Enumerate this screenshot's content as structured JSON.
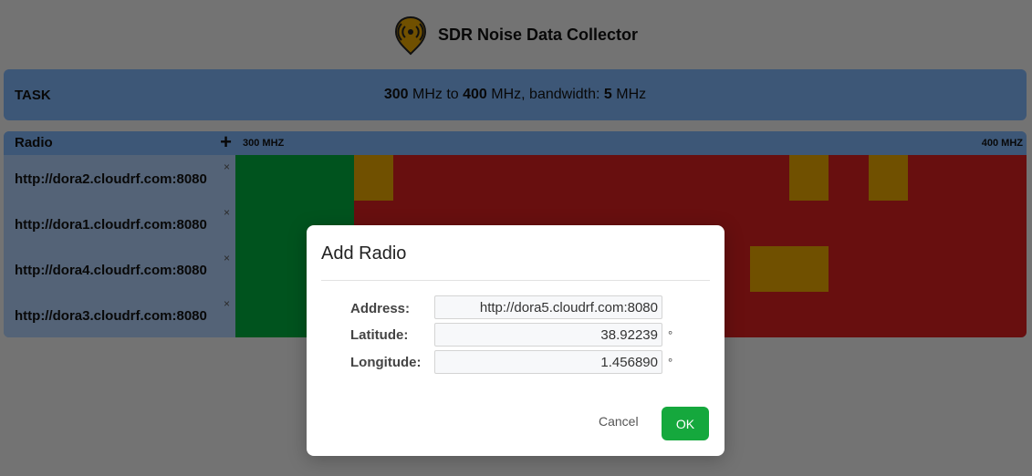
{
  "app": {
    "title": "SDR Noise Data Collector"
  },
  "task": {
    "label": "TASK",
    "freq_from": "300",
    "unit_from": "MHz",
    "to_word": "to",
    "freq_to": "400",
    "unit_to": "MHz, bandwidth:",
    "bandwidth": "5",
    "bandwidth_unit": "MHz"
  },
  "radios": {
    "header": "Radio",
    "add_symbol": "+",
    "remove_symbol": "×",
    "freq_start": "300 MHZ",
    "freq_end": "400 MHZ",
    "items": [
      {
        "url": "http://dora2.cloudrf.com:8080"
      },
      {
        "url": "http://dora1.cloudrf.com:8080"
      },
      {
        "url": "http://dora4.cloudrf.com:8080"
      },
      {
        "url": "http://dora3.cloudrf.com:8080"
      }
    ]
  },
  "colors": {
    "good": "#00a63c",
    "warn": "#e0a000",
    "bad": "#d01f1f"
  },
  "modal": {
    "title": "Add Radio",
    "address_label": "Address:",
    "address_value": "http://dora5.cloudrf.com:8080",
    "latitude_label": "Latitude:",
    "latitude_value": "38.92239",
    "longitude_label": "Longitude:",
    "longitude_value": "1.456890",
    "degree_unit": "°",
    "cancel_label": "Cancel",
    "ok_label": "OK"
  }
}
